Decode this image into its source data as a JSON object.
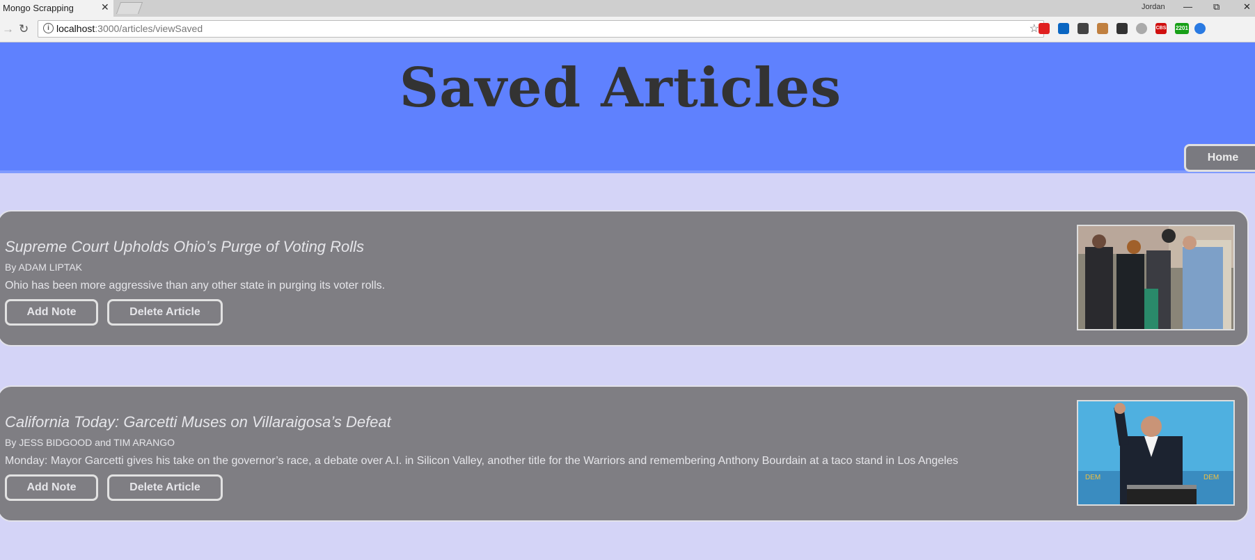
{
  "browser": {
    "tab_title": "Mongo Scrapping",
    "tab_close": "✕",
    "profile_name": "Jordan",
    "url_host": "localhost",
    "url_rest": ":3000/articles/viewSaved",
    "extensions": [
      {
        "name": "opera-icon",
        "color": "#e02020"
      },
      {
        "name": "linkedin-icon",
        "color": "#0a66c2"
      },
      {
        "name": "eyedropper-icon",
        "color": "#444444"
      },
      {
        "name": "hammer-icon",
        "color": "#c08040"
      },
      {
        "name": "screenshot-icon",
        "color": "#333333"
      },
      {
        "name": "circle-icon",
        "color": "#aaaaaa"
      },
      {
        "name": "cbs-icon",
        "color": "#d01010"
      },
      {
        "name": "counter-badge-icon",
        "color": "#18a018"
      },
      {
        "name": "blue-dot-icon",
        "color": "#2a7ae2"
      }
    ],
    "counter_badge": "2201",
    "cbs_label": "CBS"
  },
  "page": {
    "title": "Saved Articles",
    "home_label": "Home"
  },
  "articles": [
    {
      "title": "Supreme Court Upholds Ohio’s Purge of Voting Rolls",
      "byline": "By ADAM LIPTAK",
      "summary": "Ohio has been more aggressive than any other state in purging its voter rolls.",
      "add_note_label": "Add Note",
      "delete_label": "Delete Article"
    },
    {
      "title": "California Today: Garcetti Muses on Villaraigosa’s Defeat",
      "byline": "By JESS BIDGOOD and TIM ARANGO",
      "summary": "Monday: Mayor Garcetti gives his take on the governor’s race, a debate over A.I. in Silicon Valley, another title for the Warriors and remembering Anthony Bourdain at a taco stand in Los Angeles",
      "add_note_label": "Add Note",
      "delete_label": "Delete Article"
    }
  ],
  "colors": {
    "header_bg": "#5f81fe",
    "page_bg": "#d4d4f7",
    "card_bg": "#7f7e83"
  }
}
